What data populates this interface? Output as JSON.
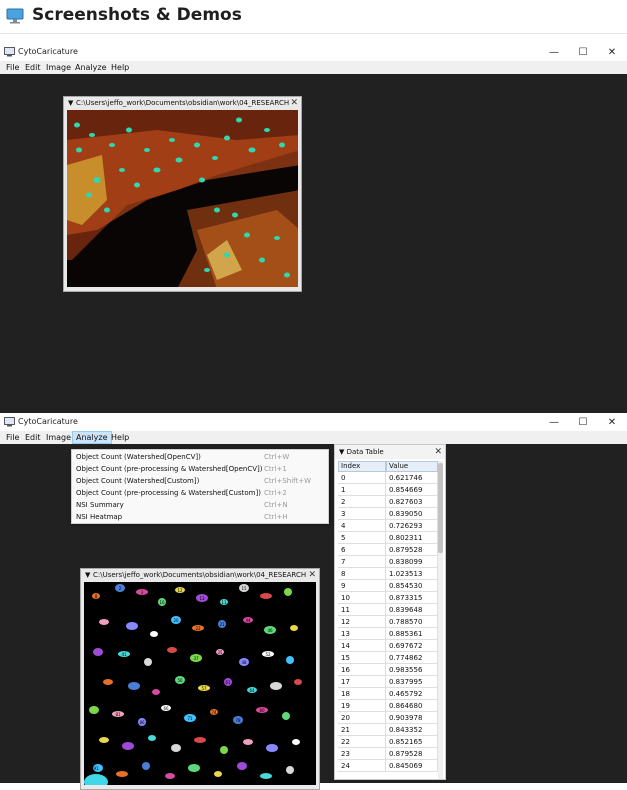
{
  "header": {
    "title": "Screenshots & Demos",
    "icon": "monitor-icon"
  },
  "app": {
    "title": "CytoCaricature",
    "menus": [
      "File",
      "Edit",
      "Image",
      "Analyze",
      "Help"
    ],
    "controls": {
      "minimize": "—",
      "maximize": "☐",
      "close": "✕"
    }
  },
  "screen1": {
    "subwindow_title": "C:\\Users\\jeffo_work\\Documents\\obsidian\\work\\04_RESEARCH"
  },
  "screen2": {
    "active_menu": "Analyze",
    "subwindow_title": "C:\\Users\\jeffo_work\\Documents\\obsidian\\work\\04_RESEARCH",
    "analyze_menu": [
      {
        "label": "Object Count (Watershed[OpenCV])",
        "shortcut": "Ctrl+W"
      },
      {
        "label": "Object Count (pre-processing & Watershed[OpenCV])",
        "shortcut": "Ctrl+1"
      },
      {
        "label": "Object Count (Watershed[Custom])",
        "shortcut": "Ctrl+Shift+W"
      },
      {
        "label": "Object Count (pre-processing & Watershed[Custom])",
        "shortcut": "Ctrl+2"
      },
      {
        "label": "NSI Summary",
        "shortcut": "Ctrl+N"
      },
      {
        "label": "NSI Heatmap",
        "shortcut": "Ctrl+H"
      }
    ],
    "data_table": {
      "title": "Data Table",
      "columns": [
        "Index",
        "Value"
      ],
      "rows": [
        [
          "0",
          "0.621746"
        ],
        [
          "1",
          "0.854669"
        ],
        [
          "2",
          "0.827603"
        ],
        [
          "3",
          "0.839050"
        ],
        [
          "4",
          "0.726293"
        ],
        [
          "5",
          "0.802311"
        ],
        [
          "6",
          "0.879528"
        ],
        [
          "7",
          "0.838099"
        ],
        [
          "8",
          "1.023513"
        ],
        [
          "9",
          "0.854530"
        ],
        [
          "10",
          "0.873315"
        ],
        [
          "11",
          "0.839648"
        ],
        [
          "12",
          "0.788570"
        ],
        [
          "13",
          "0.885361"
        ],
        [
          "14",
          "0.697672"
        ],
        [
          "15",
          "0.774862"
        ],
        [
          "16",
          "0.983556"
        ],
        [
          "17",
          "0.837995"
        ],
        [
          "18",
          "0.465792"
        ],
        [
          "19",
          "0.864680"
        ],
        [
          "20",
          "0.903978"
        ],
        [
          "21",
          "0.843352"
        ],
        [
          "22",
          "0.852165"
        ],
        [
          "23",
          "0.879528"
        ],
        [
          "24",
          "0.845069"
        ]
      ]
    },
    "cell_labels": [
      "8",
      "2",
      "3",
      "10",
      "12",
      "11",
      "13",
      "15",
      "20",
      "22",
      "21",
      "37",
      "35",
      "41",
      "44",
      "46",
      "48",
      "52",
      "56",
      "57",
      "61",
      "64",
      "66",
      "71",
      "74",
      "78",
      "80",
      "81",
      "86",
      "91"
    ]
  },
  "colors": {
    "dark_canvas": "#212121",
    "menu_highlight": "#cce4f7",
    "table_header": "#e6eef8"
  }
}
